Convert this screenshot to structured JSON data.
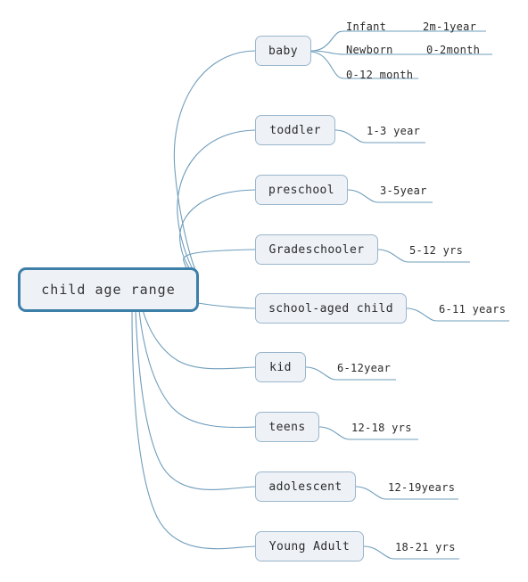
{
  "diagram": {
    "type": "mind-map",
    "title": "child age range",
    "colors": {
      "root_border": "#3d7fa8",
      "node_border": "#9ab6cc",
      "node_fill": "#eef2f7",
      "connector": "#6f9dbb",
      "text": "#2b2b2b",
      "background": "#ffffff"
    },
    "root": {
      "label": "child age range"
    },
    "branches": [
      {
        "label": "baby",
        "sub_branches": [
          {
            "label": "Infant",
            "range": "2m-1year"
          },
          {
            "label": "Newborn",
            "range": "0-2month"
          },
          {
            "label": "0-12 month",
            "range": ""
          }
        ]
      },
      {
        "label": "toddler",
        "range": "1-3 year"
      },
      {
        "label": "preschool",
        "range": "3-5year"
      },
      {
        "label": "Gradeschooler",
        "range": "5-12 yrs"
      },
      {
        "label": "school-aged child",
        "range": "6-11 years"
      },
      {
        "label": "kid",
        "range": "6-12year"
      },
      {
        "label": "teens",
        "range": "12-18 yrs"
      },
      {
        "label": "adolescent",
        "range": "12-19years"
      },
      {
        "label": "Young Adult",
        "range": "18-21 yrs"
      }
    ]
  }
}
